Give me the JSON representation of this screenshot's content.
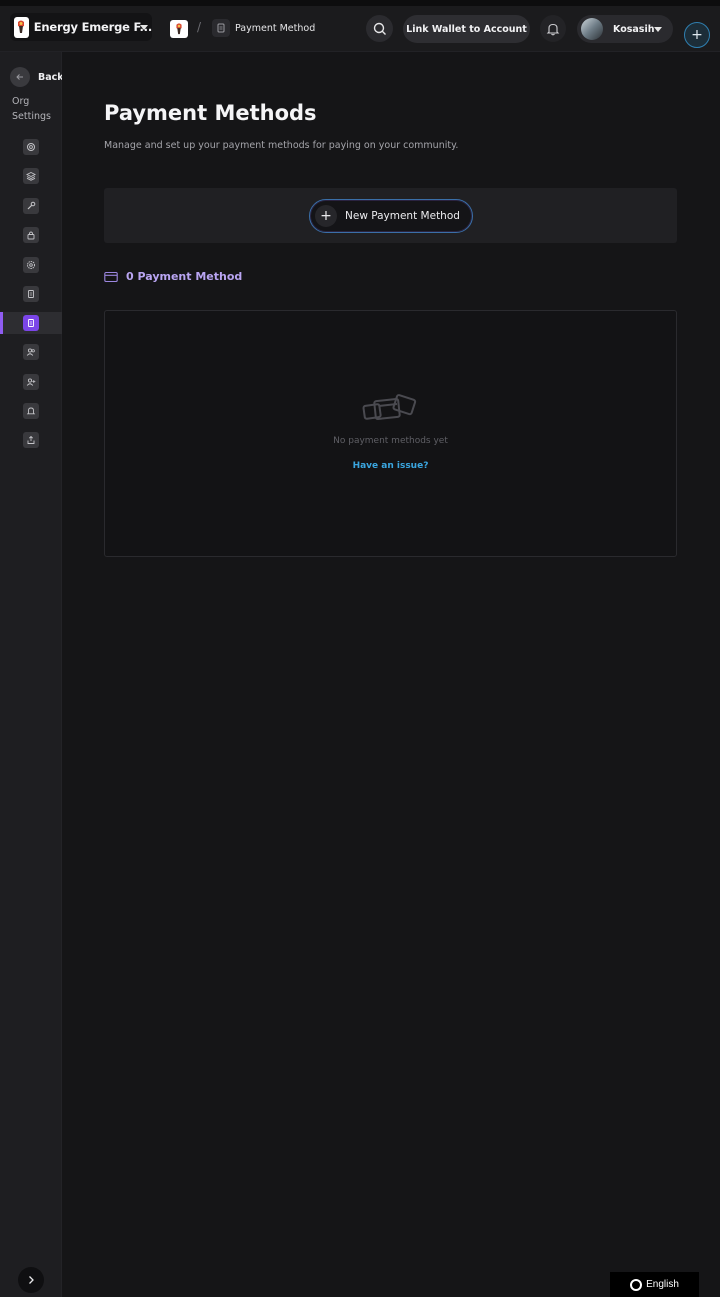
{
  "header": {
    "org_name": "Energy Emerge F...",
    "breadcrumb_page": "Payment Method",
    "breadcrumb_separator": "/",
    "link_wallet_label": "Link Wallet to Account",
    "user_name": "Kosasih",
    "plus_symbol": "+"
  },
  "sidebar": {
    "back_label": "Back",
    "section_title": "Org Settings",
    "items": [
      {
        "icon": "settings-icon"
      },
      {
        "icon": "layers-icon"
      },
      {
        "icon": "wrench-icon"
      },
      {
        "icon": "lock-icon"
      },
      {
        "icon": "gear-icon"
      },
      {
        "icon": "document-icon"
      },
      {
        "icon": "payment-document-icon",
        "active": true
      },
      {
        "icon": "users-icon"
      },
      {
        "icon": "add-user-icon"
      },
      {
        "icon": "bell-icon"
      },
      {
        "icon": "export-icon"
      }
    ]
  },
  "main": {
    "title": "Payment Methods",
    "subtitle": "Manage and set up your payment methods for paying on your community.",
    "new_button_label": "New Payment Method",
    "new_button_symbol": "+",
    "count_label": "0 Payment Method",
    "empty_text": "No payment methods yet",
    "issue_link": "Have an issue?"
  },
  "footer": {
    "language": "English"
  },
  "colors": {
    "accent": "#7b45e8",
    "link": "#3aa6e0",
    "count_text": "#b9a5f2",
    "background": "#151517"
  }
}
